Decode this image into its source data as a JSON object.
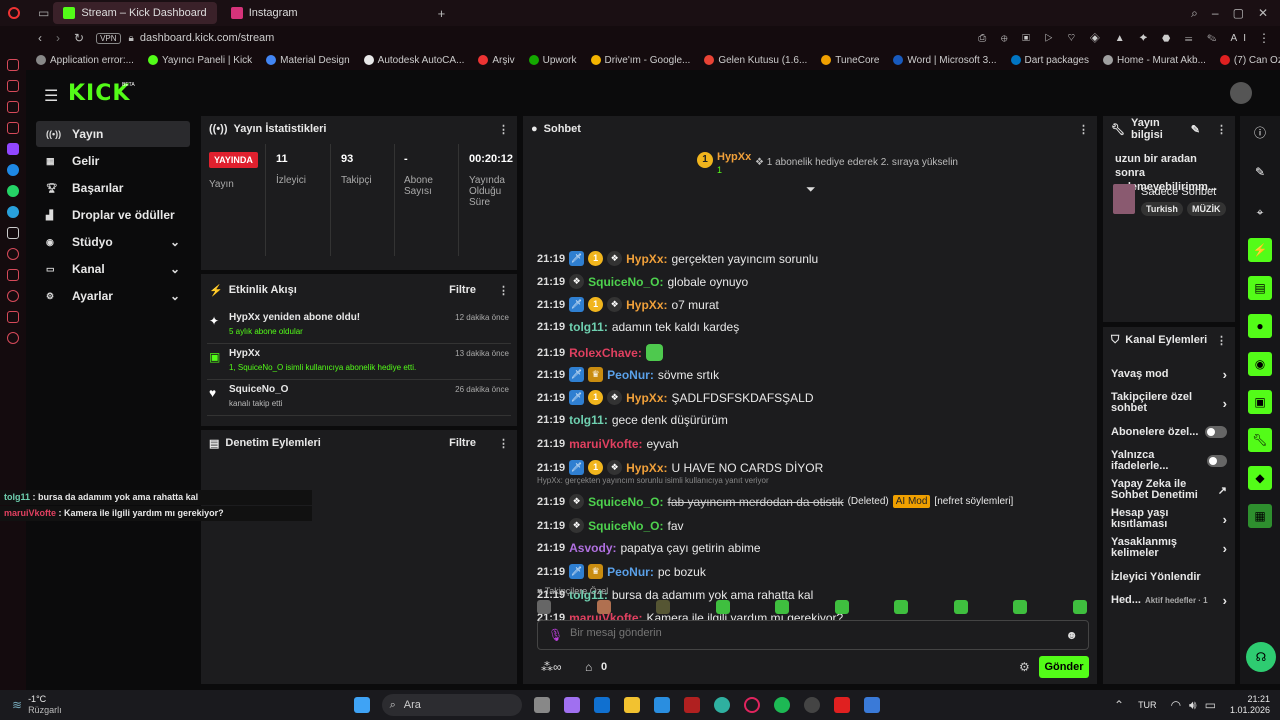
{
  "browser": {
    "tabs": [
      {
        "label": "Stream – Kick Dashboard"
      },
      {
        "label": "Instagram"
      }
    ],
    "vpn": "VPN",
    "url": "dashboard.kick.com/stream",
    "bookmarks": [
      "Application error:...",
      "Yayıncı Paneli | Kick",
      "Material Design",
      "Autodesk AutoCA...",
      "Arşiv",
      "Upwork",
      "Drive'ım - Google...",
      "Gelen Kutusu (1.6...",
      "TuneCore",
      "Word | Microsoft 3...",
      "Dart packages",
      "Home - Murat Akb...",
      "(7) Can Ozan - To..."
    ]
  },
  "kick": {
    "logo": "KICK",
    "beta": "BETA",
    "nav": [
      {
        "label": "Yayın",
        "icon": "broadcast-icon"
      },
      {
        "label": "Gelir",
        "icon": "revenue-icon"
      },
      {
        "label": "Başarılar",
        "icon": "trophy-icon"
      },
      {
        "label": "Droplar ve ödüller",
        "icon": "drops-icon"
      },
      {
        "label": "Stüdyo",
        "icon": "studio-icon"
      },
      {
        "label": "Kanal",
        "icon": "channel-icon"
      },
      {
        "label": "Ayarlar",
        "icon": "settings-icon"
      }
    ],
    "stats": {
      "title": "Yayın İstatistikleri",
      "live": "YAYINDA",
      "live_label": "Yayın",
      "viewers": "11",
      "viewers_label": "İzleyici",
      "followers": "93",
      "followers_label": "Takipçi",
      "subs": "-",
      "subs_label": "Abone Sayısı",
      "uptime": "00:20:12",
      "uptime_label": "Yayında Olduğu Süre"
    },
    "activity": {
      "title": "Etkinlik Akışı",
      "filter": "Filtre",
      "items": [
        {
          "title": "HypXx yeniden abone oldu!",
          "sub": "5 aylık abone oldular",
          "time": "12 dakika önce"
        },
        {
          "title": "HypXx",
          "sub": "1, SquiceNo_O isimli kullanıcıya abonelik hediye etti.",
          "time": "13 dakika önce"
        },
        {
          "title": "SquiceNo_O",
          "sub": "kanalı takip etti",
          "time": "26 dakika önce"
        }
      ]
    },
    "mod": {
      "title": "Denetim Eylemleri",
      "filter": "Filtre"
    },
    "overlay": [
      {
        "user": "tolg11",
        "text": " : bursa da adamım yok ama rahatta kal",
        "color": "#6fd0b0"
      },
      {
        "user": "maruiVkofte",
        "text": " : Kamera ile ilgili yardım mı gerekiyor?",
        "color": "#e04060"
      }
    ],
    "chat": {
      "title": "Sohbet",
      "pinned_user": "HypXx",
      "pinned_count": "1",
      "pinned_text": "1 abonelik hediye ederek 2. sıraya yükselin",
      "messages": [
        {
          "time": "21:19",
          "user": "HypXx:",
          "text": " gerçekten yayıncım sorunlu",
          "color": "#f0a03a",
          "badges": [
            "vip",
            "sub",
            "gift"
          ]
        },
        {
          "time": "21:19",
          "user": "SquiceNo_O:",
          "text": " globale oynuyo",
          "color": "#4ed24e",
          "badges": [
            "gift"
          ]
        },
        {
          "time": "21:19",
          "user": "HypXx:",
          "text": " o7 murat",
          "color": "#f0a03a",
          "badges": [
            "vip",
            "sub",
            "gift"
          ]
        },
        {
          "time": "21:19",
          "user": "tolg11:",
          "text": " adamın tek kaldı kardeş",
          "color": "#6fd0b0",
          "badges": []
        },
        {
          "time": "21:19",
          "user": "RolexChave:",
          "text": "",
          "color": "#e04060",
          "badges": [],
          "emote": true
        },
        {
          "time": "21:19",
          "user": "PeoNur:",
          "text": " sövme srtık",
          "color": "#5aa0e8",
          "badges": [
            "vip",
            "crown"
          ]
        },
        {
          "time": "21:19",
          "user": "HypXx:",
          "text": " ŞADLFDSFSKDAFSŞALD",
          "color": "#f0a03a",
          "badges": [
            "vip",
            "sub",
            "gift"
          ]
        },
        {
          "time": "21:19",
          "user": "tolg11:",
          "text": " gece denk düşürürüm",
          "color": "#6fd0b0",
          "badges": []
        },
        {
          "time": "21:19",
          "user": "maruiVkofte:",
          "text": " eyvah",
          "color": "#e04060",
          "badges": []
        },
        {
          "time": "21:19",
          "user": "HypXx:",
          "text": " U HAVE NO CARDS DİYOR",
          "color": "#f0a03a",
          "badges": [
            "vip",
            "sub",
            "gift"
          ]
        },
        {
          "time": "21:19",
          "user": "SquiceNo_O:",
          "text": " fab yayıncım merdodan da otistik",
          "color": "#4ed24e",
          "badges": [
            "gift"
          ],
          "deleted": true,
          "tags": "(Deleted)",
          "ai": "AI Mod",
          "reason": "[nefret söylemleri]",
          "reply": "HypXx: gerçekten yayıncım sorunlu isimli kullanıcıya yanıt veriyor"
        },
        {
          "time": "21:19",
          "user": "SquiceNo_O:",
          "text": " fav",
          "color": "#4ed24e",
          "badges": [
            "gift"
          ]
        },
        {
          "time": "21:19",
          "user": "Asvody:",
          "text": " papatya çayı getirin abime",
          "color": "#b070e0",
          "badges": []
        },
        {
          "time": "21:19",
          "user": "PeoNur:",
          "text": " pc bozuk",
          "color": "#5aa0e8",
          "badges": [
            "vip",
            "crown"
          ]
        },
        {
          "time": "21:19",
          "user": "tolg11:",
          "text": " bursa da adamım yok ama rahatta kal",
          "color": "#6fd0b0",
          "badges": []
        },
        {
          "time": "21:19",
          "user": "maruiVkofte:",
          "text": " Kamera ile ilgili yardım mı gerekiyor?",
          "color": "#e04060",
          "badges": []
        }
      ],
      "followers_only": "Takipçilere Özel",
      "placeholder": "Bir mesaj gönderin",
      "points": "0",
      "send": "Gönder"
    },
    "info": {
      "title": "Yayın bilgisi",
      "stream_title": "uzun bir aradan sonra gelemeyebilirimm...",
      "category": "Sadece Sohbet",
      "tags": [
        "Turkish",
        "MÜZİK"
      ]
    },
    "actions": {
      "title": "Kanal Eylemleri",
      "items": [
        {
          "label": "Yavaş mod",
          "kind": "chev"
        },
        {
          "label": "Takipçilere özel sohbet",
          "kind": "chev"
        },
        {
          "label": "Abonelere özel...",
          "kind": "tog"
        },
        {
          "label": "Yalnızca ifadelerle...",
          "kind": "tog"
        },
        {
          "label": "Yapay Zeka ile Sohbet Denetimi",
          "kind": "ext"
        },
        {
          "label": "Hesap yaşı kısıtlaması",
          "kind": "chev"
        },
        {
          "label": "Yasaklanmış kelimeler",
          "kind": "chev"
        },
        {
          "label": "İzleyici Yönlendir",
          "kind": ""
        },
        {
          "label": "Hed...",
          "kind": "chev",
          "extra": "Aktif hedefler · 1"
        }
      ]
    }
  },
  "taskbar": {
    "weather_temp": "-1°C",
    "weather_label": "Rüzgarlı",
    "search": "Ara",
    "lang": "TUR",
    "time": "21:21",
    "date": "1.01.2026"
  },
  "colors": {
    "kick_green": "#53fc18",
    "live_red": "#e0202e"
  }
}
